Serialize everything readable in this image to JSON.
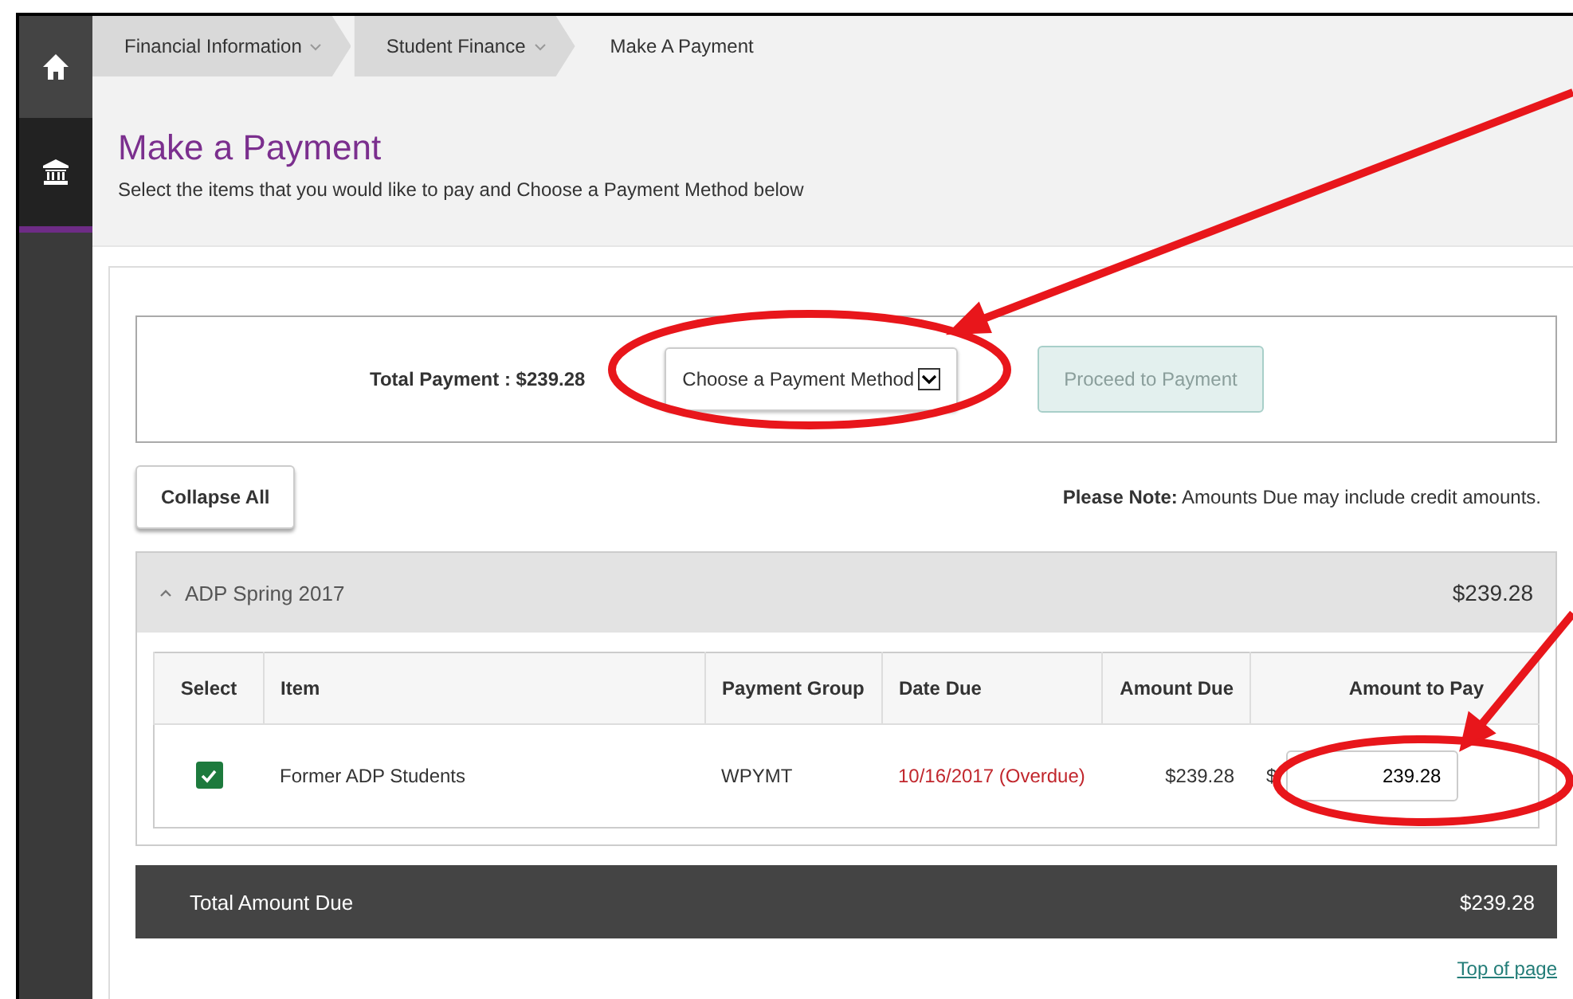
{
  "sidebar": {
    "items": [
      {
        "kind": "home",
        "selected": false
      },
      {
        "kind": "bank",
        "selected": true
      }
    ]
  },
  "breadcrumbs": [
    {
      "label": "Financial Information",
      "dropdown": true
    },
    {
      "label": "Student Finance",
      "dropdown": true
    },
    {
      "label": "Make A Payment",
      "dropdown": false
    }
  ],
  "header": {
    "title": "Make a Payment",
    "subtitle": "Select the items that you would like to pay and Choose a Payment Method below"
  },
  "payment_bar": {
    "total_label": "Total Payment : $239.28",
    "method_select": {
      "value": "Choose a Payment Method"
    },
    "proceed_button": {
      "label": "Proceed to Payment",
      "disabled": true
    }
  },
  "collapse_button": "Collapse All",
  "note": "**Please Note:** Amounts Due may include credit amounts.",
  "section": {
    "title": "ADP Spring 2017",
    "total": "$239.28",
    "expanded": true,
    "table": {
      "columns": [
        "Select",
        "Item",
        "Payment Group",
        "Date Due",
        "Amount Due",
        "Amount to Pay"
      ],
      "rows": [
        {
          "checked": true,
          "item": "Former ADP Students",
          "payment_group": "WPYMT",
          "date_due": "10/16/2017 (Overdue)",
          "overdue": true,
          "amount_due": "$239.28",
          "currency": "$",
          "amount_to_pay": "239.28"
        }
      ]
    }
  },
  "total_amount_due": {
    "label": "Total Amount Due",
    "value": "$239.28"
  },
  "top_link": "Top of page"
}
